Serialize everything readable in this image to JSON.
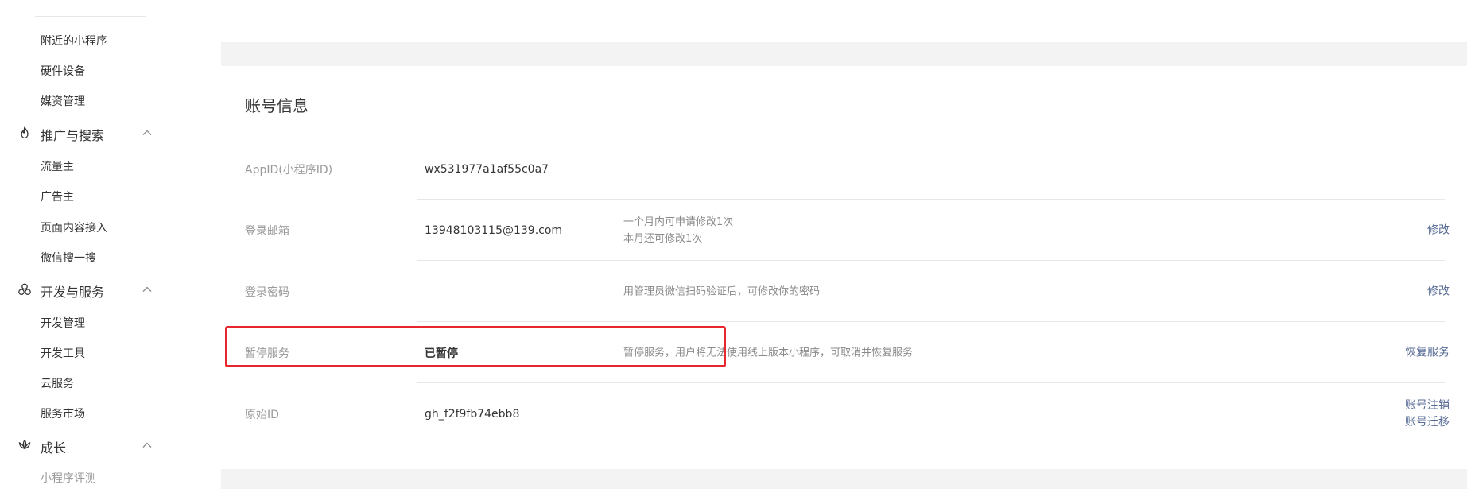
{
  "sidebar": {
    "items_top": [
      {
        "label": "附近的小程序"
      },
      {
        "label": "硬件设备"
      },
      {
        "label": "媒资管理"
      }
    ],
    "groups": [
      {
        "label": "推广与搜索",
        "icon": "flame-icon",
        "items": [
          {
            "label": "流量主"
          },
          {
            "label": "广告主"
          },
          {
            "label": "页面内容接入"
          },
          {
            "label": "微信搜一搜"
          }
        ]
      },
      {
        "label": "开发与服务",
        "icon": "dev-service-icon",
        "items": [
          {
            "label": "开发管理"
          },
          {
            "label": "开发工具"
          },
          {
            "label": "云服务"
          },
          {
            "label": "服务市场"
          }
        ]
      },
      {
        "label": "成长",
        "icon": "growth-icon",
        "items": [
          {
            "label": "小程序评测"
          }
        ]
      }
    ]
  },
  "account": {
    "title": "账号信息",
    "rows": [
      {
        "label": "AppID(小程序ID)",
        "value": "wx531977a1af55c0a7"
      },
      {
        "label": "登录邮箱",
        "value": "13948103115@139.com",
        "desc": [
          "一个月内可申请修改1次",
          "本月还可修改1次"
        ],
        "actions": [
          "修改"
        ]
      },
      {
        "label": "登录密码",
        "value": "",
        "desc": [
          "用管理员微信扫码验证后，可修改你的密码"
        ],
        "actions": [
          "修改"
        ]
      },
      {
        "label": "暂停服务",
        "value": "已暂停",
        "desc": [
          "暂停服务，用户将无法使用线上版本小程序，可取消并恢复服务"
        ],
        "actions": [
          "恢复服务"
        ]
      },
      {
        "label": "原始ID",
        "value": "gh_f2f9fb74ebb8",
        "actions": [
          "账号注销",
          "账号迁移"
        ]
      }
    ]
  },
  "colors": {
    "link": "#576b95",
    "highlight": "#e8262d",
    "label_gray": "#9a9a9a",
    "background": "#f3f3f3"
  }
}
